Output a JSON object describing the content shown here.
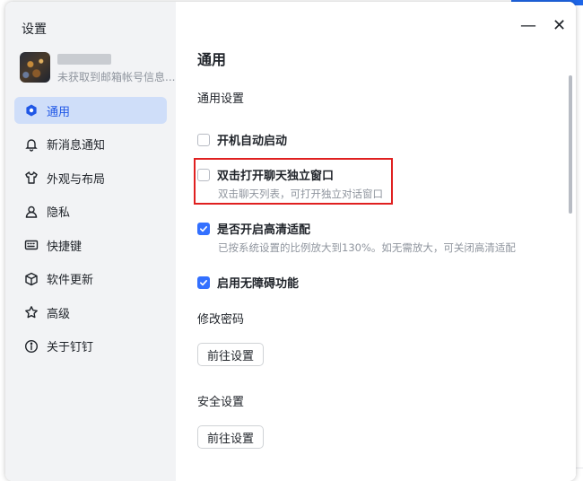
{
  "window": {
    "title": "设置"
  },
  "profile": {
    "name": "",
    "subtitle": "未获取到邮箱帐号信息..."
  },
  "sidebar": {
    "items": [
      {
        "label": "通用",
        "icon": "gear-hex-icon",
        "active": true
      },
      {
        "label": "新消息通知",
        "icon": "bell-icon"
      },
      {
        "label": "外观与布局",
        "icon": "shirt-icon"
      },
      {
        "label": "隐私",
        "icon": "person-icon"
      },
      {
        "label": "快捷键",
        "icon": "keyboard-icon"
      },
      {
        "label": "软件更新",
        "icon": "box-icon"
      },
      {
        "label": "高级",
        "icon": "star-icon"
      },
      {
        "label": "关于钉钉",
        "icon": "info-icon"
      }
    ]
  },
  "controls": {
    "minimize": "—",
    "close": "✕"
  },
  "main": {
    "title": "通用",
    "general_section": "通用设置",
    "options": [
      {
        "label": "开机自动启动",
        "checked": false,
        "desc": ""
      },
      {
        "label": "双击打开聊天独立窗口",
        "checked": false,
        "desc": "双击聊天列表，可打开独立对话窗口"
      },
      {
        "label": "是否开启高清适配",
        "checked": true,
        "desc": "已按系统设置的比例放大到130%。如无需放大，可关闭高清适配"
      },
      {
        "label": "启用无障碍功能",
        "checked": true,
        "desc": ""
      }
    ],
    "password_section": "修改密码",
    "password_button": "前往设置",
    "security_section": "安全设置",
    "security_button": "前往设置"
  },
  "colors": {
    "accent": "#3370ff",
    "highlight": "#e02020",
    "sidebar_bg": "#f2f3f5"
  }
}
